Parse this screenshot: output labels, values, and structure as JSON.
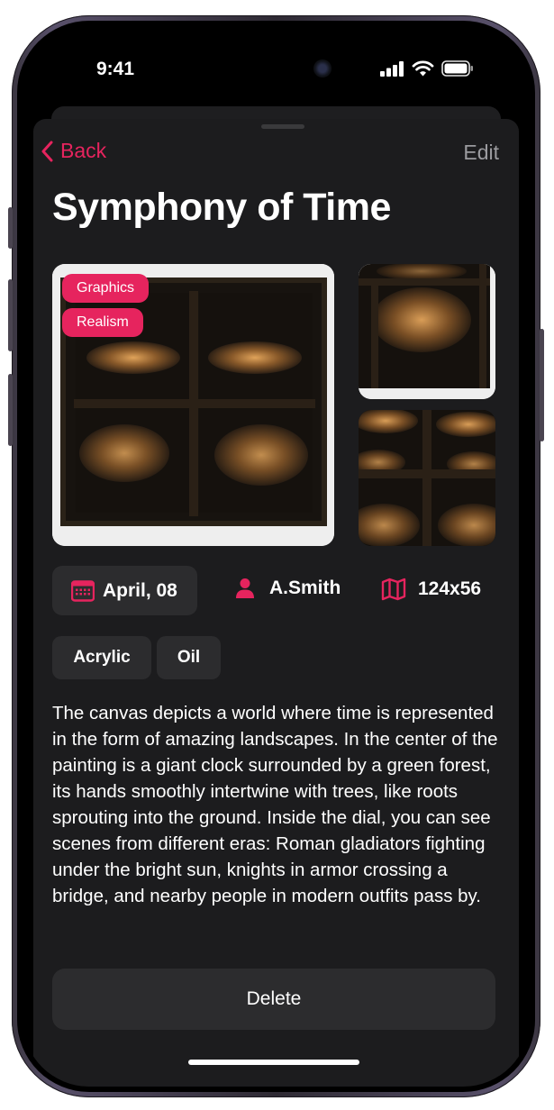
{
  "status_bar": {
    "time": "9:41"
  },
  "nav": {
    "back_label": "Back",
    "edit_label": "Edit"
  },
  "artwork": {
    "title": "Symphony of Time",
    "tags": [
      "Graphics",
      "Realism"
    ],
    "date": "April, 08",
    "author": "A.Smith",
    "size": "124x56",
    "mediums": [
      "Acrylic",
      "Oil"
    ],
    "description": "The canvas depicts a world where time is represented in the form of amazing landscapes. In the center of the painting is a giant clock surrounded by a green forest, its hands smoothly intertwine with trees, like roots sprouting into the ground. Inside the dial, you can see scenes from different eras: Roman gladiators fighting under the bright sun, knights in armor crossing a bridge, and nearby people in modern outfits pass by."
  },
  "actions": {
    "delete_label": "Delete"
  },
  "icons": {
    "back": "chevron-left-icon",
    "date": "calendar-icon",
    "author": "person-icon",
    "size": "map-icon"
  },
  "colors": {
    "accent": "#e6245e",
    "sheet_background": "#1c1c1e",
    "chip_background": "#2c2c2e",
    "secondary_text": "#9b9b9f"
  }
}
